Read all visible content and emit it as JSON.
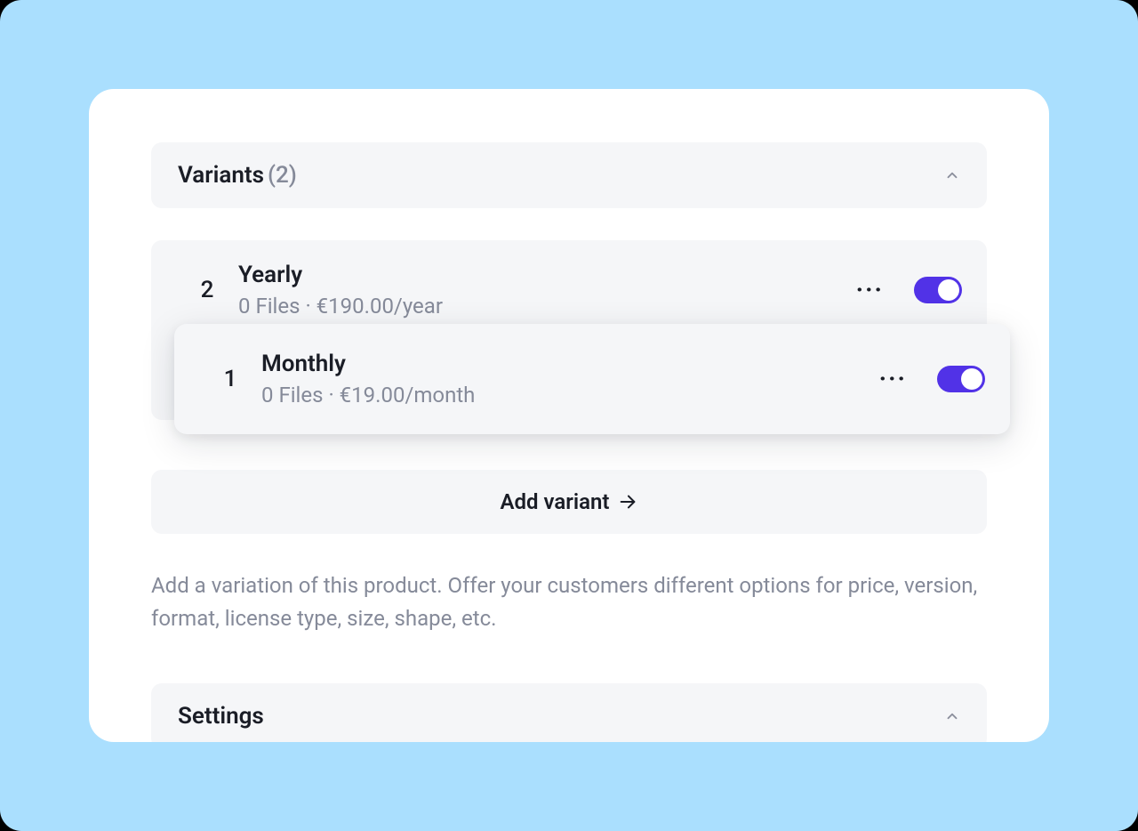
{
  "section": {
    "title": "Variants",
    "count": "(2)"
  },
  "variants": {
    "yearly": {
      "num": "2",
      "name": "Yearly",
      "meta": "0 Files · €190.00/year"
    },
    "monthly_ghost": {
      "num": "1",
      "name": "Monthly",
      "meta": "0 Files · €19.00/month"
    },
    "monthly_floating": {
      "num": "1",
      "name": "Monthly",
      "meta": "0 Files · €19.00/month"
    }
  },
  "add_button": "Add variant",
  "helper": "Add a variation of this product. Offer your customers different options for price, version, format, license type, size, shape, etc.",
  "settings": {
    "title": "Settings"
  },
  "colors": {
    "accent": "#5132e7",
    "background": "#aadffe"
  }
}
